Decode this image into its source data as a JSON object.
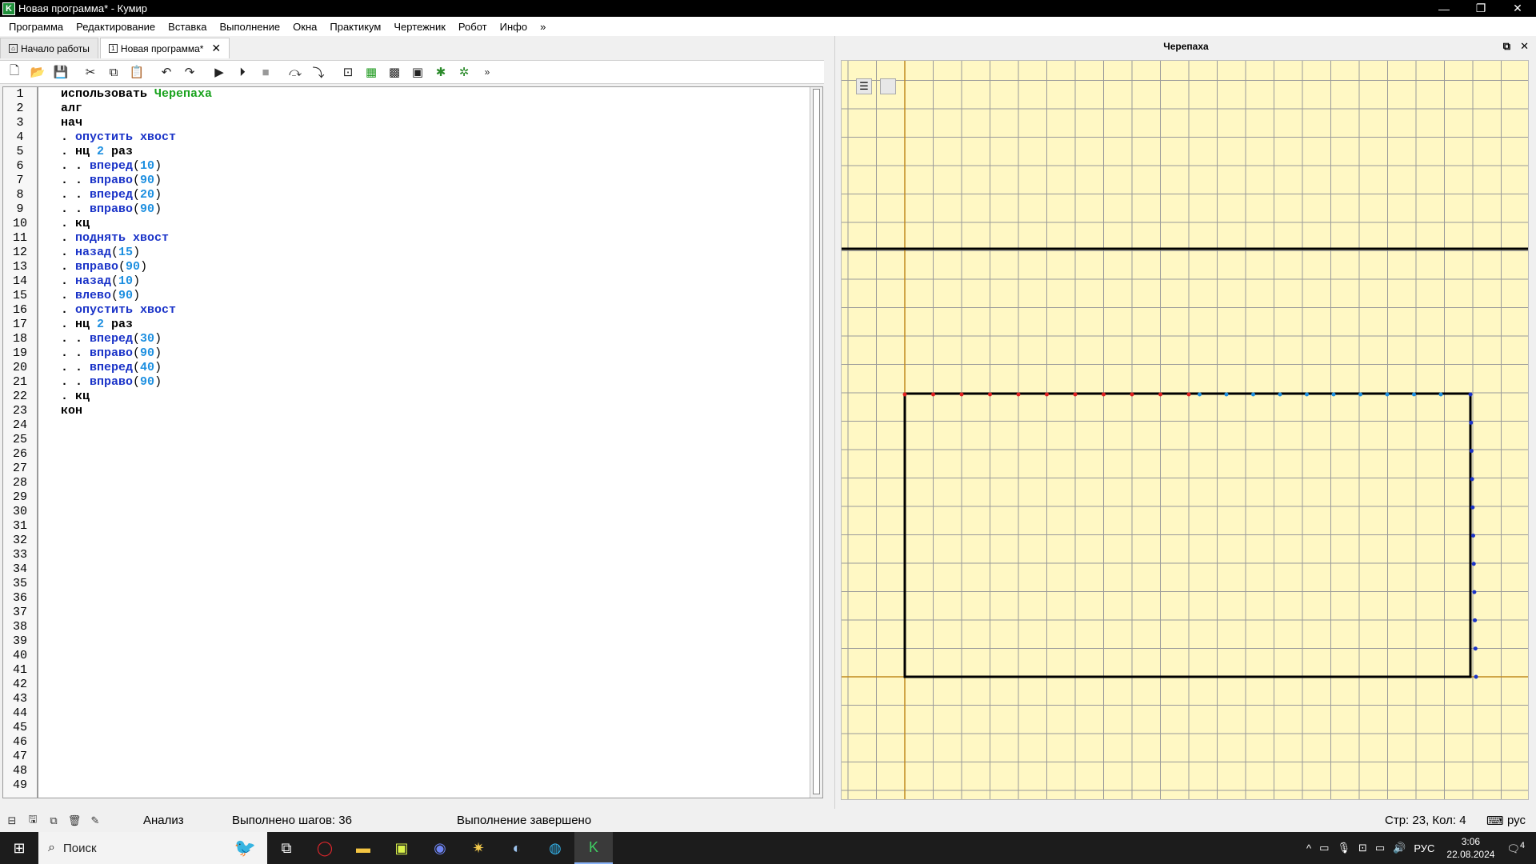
{
  "window": {
    "title": "Новая программа* - Кумир",
    "app_letter": "K"
  },
  "menu": [
    "Программа",
    "Редактирование",
    "Вставка",
    "Выполнение",
    "Окна",
    "Практикум",
    "Чертежник",
    "Робот",
    "Инфо",
    "»"
  ],
  "tabs": [
    {
      "label": "Начало работы"
    },
    {
      "label": "Новая программа*"
    }
  ],
  "code_lines": [
    [
      [
        "kw",
        "использовать "
      ],
      [
        "mod",
        "Черепаха"
      ]
    ],
    [
      [
        "kw",
        "алг"
      ]
    ],
    [
      [
        "kw",
        "нач"
      ]
    ],
    [
      [
        "kw",
        ". "
      ],
      [
        "fn",
        "опустить хвост"
      ]
    ],
    [
      [
        "kw",
        ". нц "
      ],
      [
        "num",
        "2"
      ],
      [
        "kw",
        " раз"
      ]
    ],
    [
      [
        "kw",
        ". . "
      ],
      [
        "fn",
        "вперед"
      ],
      [
        "par",
        "("
      ],
      [
        "num",
        "10"
      ],
      [
        "par",
        ")"
      ]
    ],
    [
      [
        "kw",
        ". . "
      ],
      [
        "fn",
        "вправо"
      ],
      [
        "par",
        "("
      ],
      [
        "num",
        "90"
      ],
      [
        "par",
        ")"
      ]
    ],
    [
      [
        "kw",
        ". . "
      ],
      [
        "fn",
        "вперед"
      ],
      [
        "par",
        "("
      ],
      [
        "num",
        "20"
      ],
      [
        "par",
        ")"
      ]
    ],
    [
      [
        "kw",
        ". . "
      ],
      [
        "fn",
        "вправо"
      ],
      [
        "par",
        "("
      ],
      [
        "num",
        "90"
      ],
      [
        "par",
        ")"
      ]
    ],
    [
      [
        "kw",
        ". кц"
      ]
    ],
    [
      [
        "kw",
        ". "
      ],
      [
        "fn",
        "поднять хвост"
      ]
    ],
    [
      [
        "kw",
        ". "
      ],
      [
        "fn",
        "назад"
      ],
      [
        "par",
        "("
      ],
      [
        "num",
        "15"
      ],
      [
        "par",
        ")"
      ]
    ],
    [
      [
        "kw",
        ". "
      ],
      [
        "fn",
        "вправо"
      ],
      [
        "par",
        "("
      ],
      [
        "num",
        "90"
      ],
      [
        "par",
        ")"
      ]
    ],
    [
      [
        "kw",
        ". "
      ],
      [
        "fn",
        "назад"
      ],
      [
        "par",
        "("
      ],
      [
        "num",
        "10"
      ],
      [
        "par",
        ")"
      ]
    ],
    [
      [
        "kw",
        ". "
      ],
      [
        "fn",
        "влево"
      ],
      [
        "par",
        "("
      ],
      [
        "num",
        "90"
      ],
      [
        "par",
        ")"
      ]
    ],
    [
      [
        "kw",
        ". "
      ],
      [
        "fn",
        "опустить хвост"
      ]
    ],
    [
      [
        "kw",
        ". нц "
      ],
      [
        "num",
        "2"
      ],
      [
        "kw",
        " раз"
      ]
    ],
    [
      [
        "kw",
        ". . "
      ],
      [
        "fn",
        "вперед"
      ],
      [
        "par",
        "("
      ],
      [
        "num",
        "30"
      ],
      [
        "par",
        ")"
      ]
    ],
    [
      [
        "kw",
        ". . "
      ],
      [
        "fn",
        "вправо"
      ],
      [
        "par",
        "("
      ],
      [
        "num",
        "90"
      ],
      [
        "par",
        ")"
      ]
    ],
    [
      [
        "kw",
        ". . "
      ],
      [
        "fn",
        "вперед"
      ],
      [
        "par",
        "("
      ],
      [
        "num",
        "40"
      ],
      [
        "par",
        ")"
      ]
    ],
    [
      [
        "kw",
        ". . "
      ],
      [
        "fn",
        "вправо"
      ],
      [
        "par",
        "("
      ],
      [
        "num",
        "90"
      ],
      [
        "par",
        ")"
      ]
    ],
    [
      [
        "kw",
        ". кц"
      ]
    ],
    [
      [
        "kw",
        "кон"
      ]
    ]
  ],
  "line_count": 49,
  "turtle_panel": {
    "title": "Черепаха"
  },
  "status": {
    "mode": "Анализ",
    "steps": "Выполнено шагов: 36",
    "state": "Выполнение завершено",
    "cursor": "Стр: 23, Кол: 4",
    "lang": "рус"
  },
  "taskbar": {
    "search_placeholder": "Поиск",
    "lang": "РУС",
    "time": "3:06",
    "date": "22.08.2024",
    "notif_count": "4"
  },
  "colors": {
    "canvas_bg": "#fff8c4",
    "grid": "#9a9a9a",
    "axis": "#c08a1e",
    "keyword": "#000000",
    "function": "#1a33c8",
    "number": "#1d8fe0",
    "module": "#19a21d"
  }
}
